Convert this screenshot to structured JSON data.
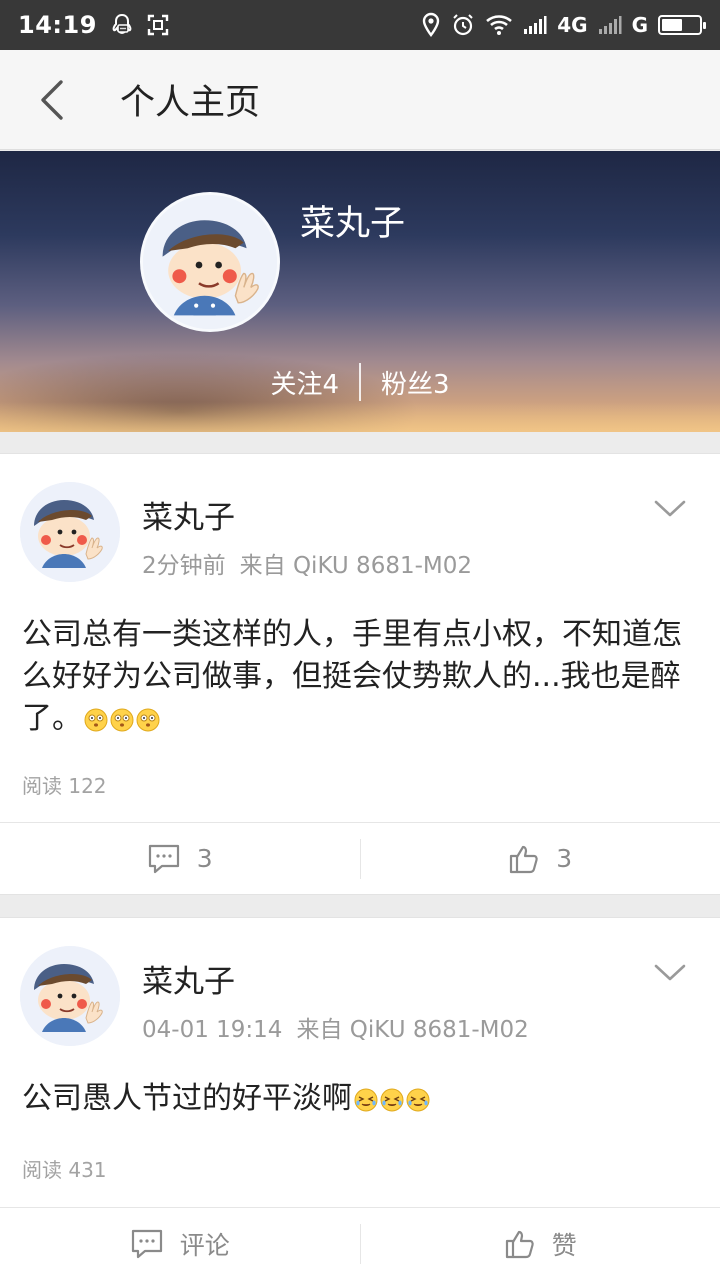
{
  "status_bar": {
    "time": "14:19",
    "network_1": "4G",
    "network_2": "G",
    "battery_level": 0.55,
    "icons": [
      "qq-notification-icon",
      "screenshot-icon",
      "location-icon",
      "alarm-icon",
      "wifi-icon",
      "signal-icon",
      "signal-icon",
      "battery-icon"
    ]
  },
  "header": {
    "title": "个人主页",
    "back_icon": "chevron-left-icon"
  },
  "profile": {
    "name": "菜丸子",
    "following": "关注4",
    "followers": "粉丝3"
  },
  "posts": [
    {
      "author": "菜丸子",
      "time": "2分钟前",
      "source": "来自 QiKU 8681-M02",
      "content": "公司总有一类这样的人，手里有点小权，不知道怎么好好为公司做事，但挺会仗势欺人的...我也是醉了。",
      "emojis": [
        "dizzy-face-emoji",
        "dizzy-face-emoji",
        "dizzy-face-emoji"
      ],
      "reads": "阅读 122",
      "comment_label": "3",
      "like_label": "3"
    },
    {
      "author": "菜丸子",
      "time": "04-01 19:14",
      "source": "来自 QiKU 8681-M02",
      "content": "公司愚人节过的好平淡啊",
      "emojis": [
        "tired-face-emoji",
        "tired-face-emoji",
        "tired-face-emoji"
      ],
      "reads": "阅读 431",
      "comment_label": "评论",
      "like_label": "赞"
    }
  ],
  "colors": {
    "status_bar": "#383838",
    "header_bg": "#f6f6f6",
    "page_bg": "#ececec",
    "meta_text": "#9a9a9a"
  }
}
